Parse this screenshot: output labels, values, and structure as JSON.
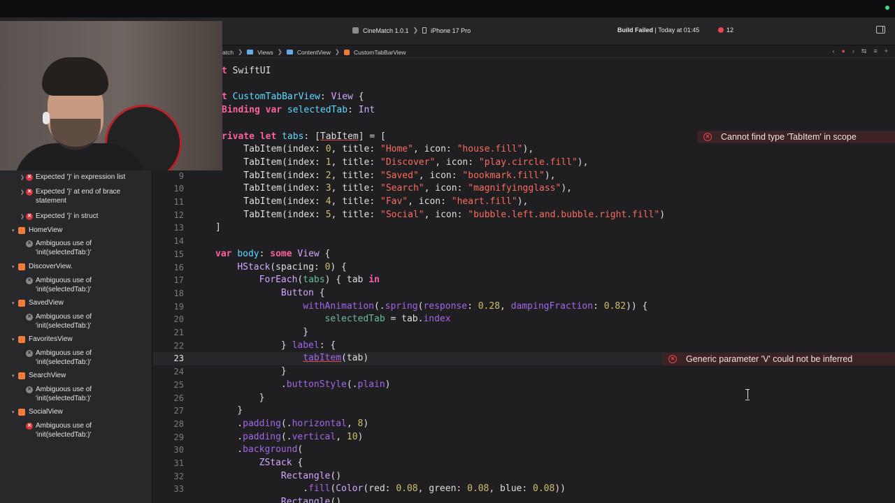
{
  "toolbar": {
    "scheme": "CineMatch 1.0.1",
    "destination": "iPhone 17 Pro",
    "build_status_strong": "Build Failed",
    "build_status_rest": " | Today at 01:45",
    "error_count": "12"
  },
  "jumpbar": {
    "crumbs": [
      "atch",
      "Views",
      "ContentView",
      "CustomTabBarView"
    ]
  },
  "issues": [
    {
      "type": "error",
      "text": "Expected ')' in expression list"
    },
    {
      "type": "error",
      "text": "Expected '}' at end of brace statement"
    },
    {
      "type": "error",
      "text": "Expected '}' in struct"
    },
    {
      "type": "group",
      "text": "HomeView"
    },
    {
      "type": "warning",
      "text": "Ambiguous use of 'init(selectedTab:)'"
    },
    {
      "type": "group",
      "text": "DiscoverView."
    },
    {
      "type": "warning",
      "text": "Ambiguous use of 'init(selectedTab:)'"
    },
    {
      "type": "group",
      "text": "SavedView"
    },
    {
      "type": "warning",
      "text": "Ambiguous use of 'init(selectedTab:)'"
    },
    {
      "type": "group",
      "text": "FavoritesView"
    },
    {
      "type": "warning",
      "text": "Ambiguous use of 'init(selectedTab:)'"
    },
    {
      "type": "group",
      "text": "SearchView"
    },
    {
      "type": "warning",
      "text": "Ambiguous use of 'init(selectedTab:)'"
    },
    {
      "type": "group",
      "text": "SocialView"
    },
    {
      "type": "error",
      "text": "Ambiguous use of 'init(selectedTab:)'"
    }
  ],
  "inline_errors": {
    "line7": "Cannot find type 'TabItem' in scope",
    "line23": "Generic parameter 'V' could not be inferred"
  },
  "code_lines": {
    "l9": "9",
    "l10": "10",
    "l11": "11",
    "l12": "12",
    "l13": "13",
    "l14": "14",
    "l15": "15",
    "l16": "16",
    "l17": "17",
    "l18": "18",
    "l19": "19",
    "l20": "20",
    "l21": "21",
    "l22": "22",
    "l23": "23",
    "l24": "24",
    "l25": "25",
    "l26": "26",
    "l27": "27",
    "l28": "28",
    "l29": "29",
    "l30": "30",
    "l31": "31",
    "l32": "32",
    "l33": "33"
  },
  "colors": {
    "error": "#e5474d",
    "keyword": "#fc5fa3",
    "string": "#fc6a5d",
    "type": "#5dd8ff",
    "number": "#d0bf69"
  }
}
